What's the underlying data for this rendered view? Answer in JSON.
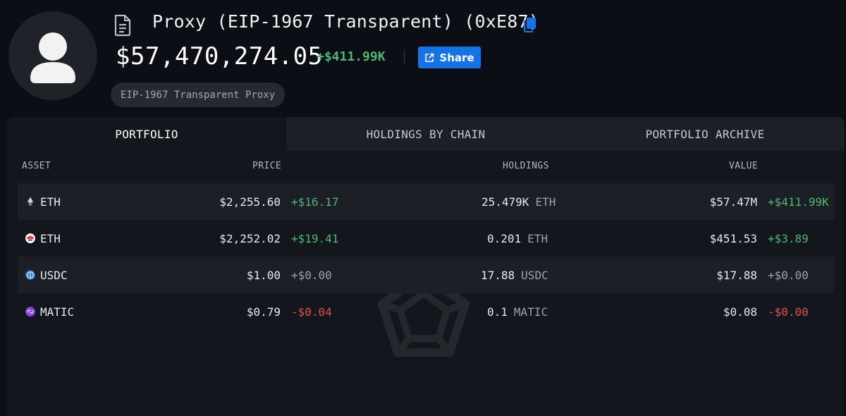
{
  "header": {
    "avatar_icon": "user-avatar-icon",
    "title": "Proxy (EIP-1967 Transparent) (0xE87)",
    "balance": "$57,470,274.05",
    "balance_change": "+$411.99K",
    "share_label": "Share",
    "tag": "EIP-1967 Transparent Proxy"
  },
  "tabs": [
    {
      "label": "PORTFOLIO",
      "active": true
    },
    {
      "label": "HOLDINGS BY CHAIN",
      "active": false
    },
    {
      "label": "PORTFOLIO ARCHIVE",
      "active": false
    }
  ],
  "columns": {
    "asset": "ASSET",
    "price": "PRICE",
    "holdings": "HOLDINGS",
    "value": "VALUE"
  },
  "rows": [
    {
      "icon": "ethereum-icon",
      "asset": "ETH",
      "price": "$2,255.60",
      "price_change": "+$16.17",
      "holdings": "25.479K",
      "symbol": "ETH",
      "value": "$57.47M",
      "value_change": "+$411.99K"
    },
    {
      "icon": "eth-red-chain-icon",
      "asset": "ETH",
      "price": "$2,252.02",
      "price_change": "+$19.41",
      "holdings": "0.201",
      "symbol": "ETH",
      "value": "$451.53",
      "value_change": "+$3.89"
    },
    {
      "icon": "usdc-icon",
      "asset": "USDC",
      "price": "$1.00",
      "price_change": "+$0.00",
      "holdings": "17.88",
      "symbol": "USDC",
      "value": "$17.88",
      "value_change": "+$0.00"
    },
    {
      "icon": "matic-icon",
      "asset": "MATIC",
      "price": "$0.79",
      "price_change": "-$0.04",
      "holdings": "0.1",
      "symbol": "MATIC",
      "value": "$0.08",
      "value_change": "-$0.00"
    }
  ],
  "colors": {
    "background": "#0b0e14",
    "panel": "#13161c",
    "accent_blue": "#1673e5",
    "positive": "#4fb774",
    "negative": "#e05252"
  }
}
